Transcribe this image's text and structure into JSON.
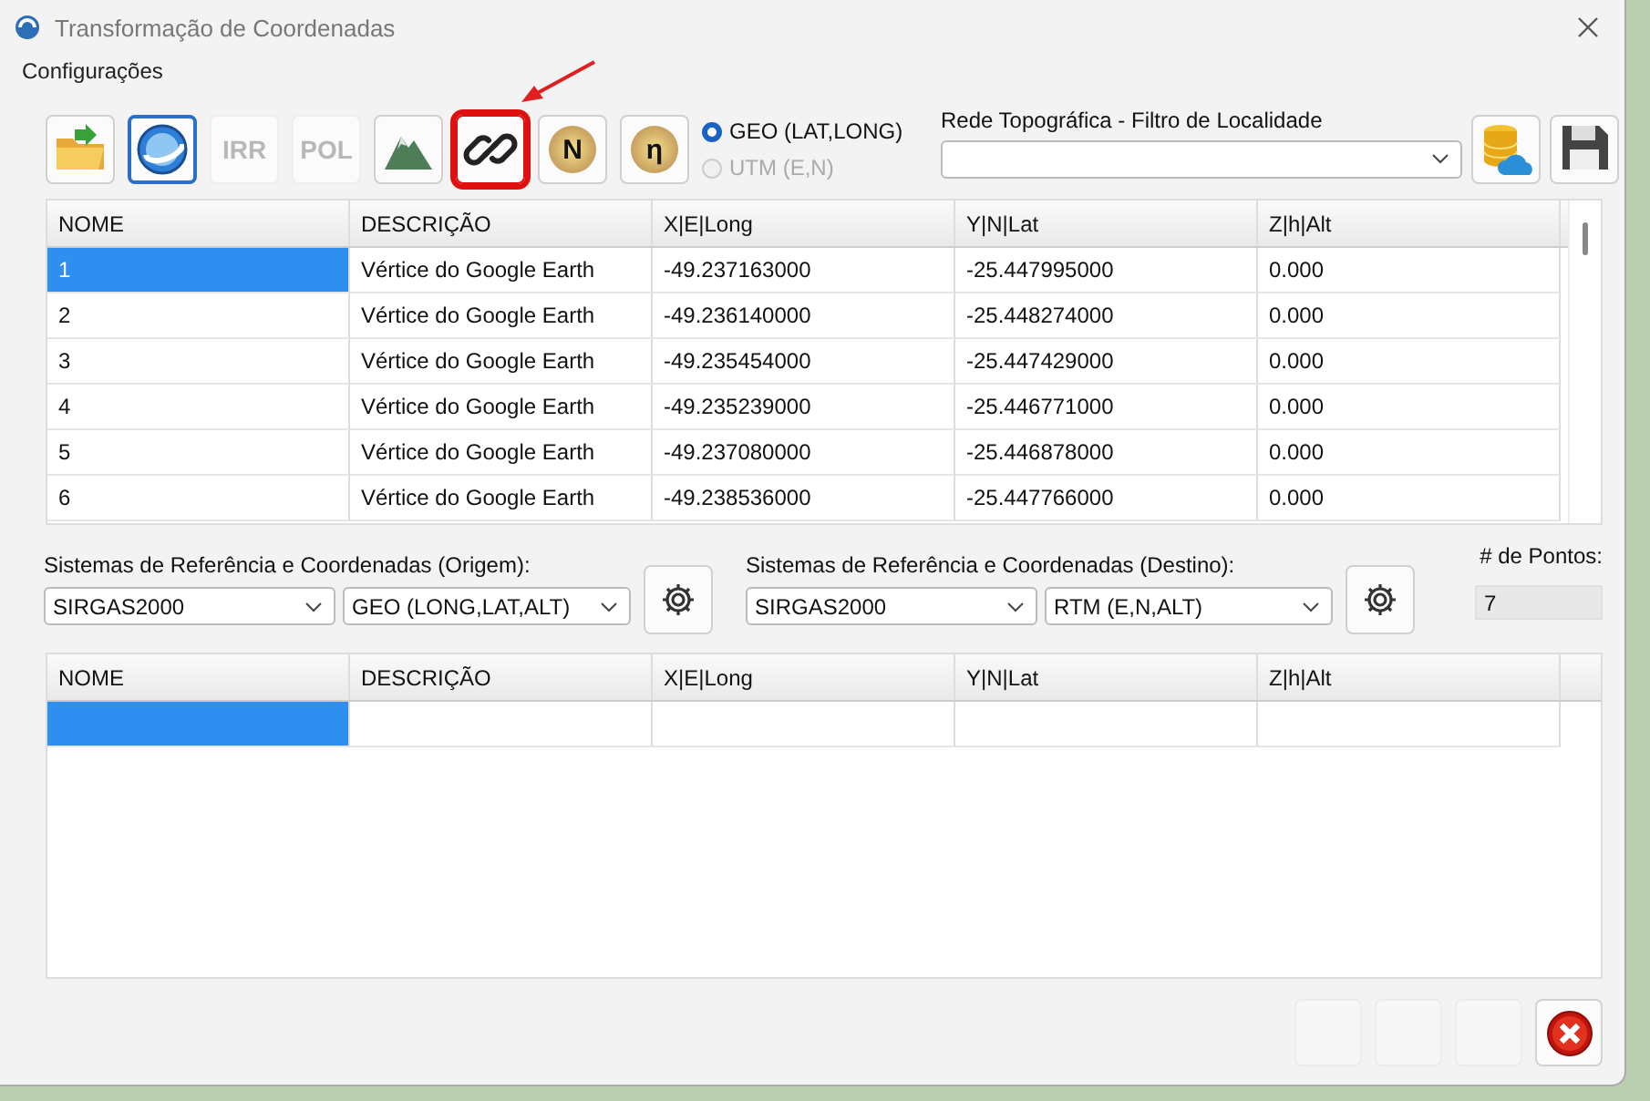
{
  "window": {
    "title": "Transformação de Coordenadas"
  },
  "menu": [
    "Configurações"
  ],
  "toolbar": {
    "buttons": [
      {
        "kind": "folder",
        "selected": false,
        "highlighted": false
      },
      {
        "kind": "globe",
        "selected": true,
        "highlighted": false
      },
      {
        "kind": "text",
        "label": "IRR",
        "selected": false,
        "highlighted": false
      },
      {
        "kind": "text",
        "label": "POL",
        "selected": false,
        "highlighted": false
      },
      {
        "kind": "mountain",
        "selected": false,
        "highlighted": false
      },
      {
        "kind": "link",
        "selected": false,
        "highlighted": true
      },
      {
        "kind": "letter",
        "label": "N",
        "selected": false,
        "highlighted": false
      },
      {
        "kind": "letter",
        "label": "η",
        "selected": false,
        "highlighted": false
      }
    ],
    "radios": [
      {
        "label": "GEO (LAT,LONG)",
        "selected": true,
        "disabled": false
      },
      {
        "label": "UTM (E,N)",
        "selected": false,
        "disabled": true
      }
    ],
    "filter_label": "Rede Topográfica - Filtro de Localidade",
    "right_buttons": [
      {
        "kind": "database-cloud"
      },
      {
        "kind": "floppy"
      }
    ]
  },
  "input_table": {
    "columns": [
      "NOME",
      "DESCRIÇÃO",
      "X|E|Long",
      "Y|N|Lat",
      "Z|h|Alt"
    ],
    "rows": [
      {
        "cells": [
          "1",
          "Vértice do Google Earth",
          "-49.237163000",
          "-25.447995000",
          "0.000"
        ],
        "selected": true
      },
      {
        "cells": [
          "2",
          "Vértice do Google Earth",
          "-49.236140000",
          "-25.448274000",
          "0.000"
        ],
        "selected": false
      },
      {
        "cells": [
          "3",
          "Vértice do Google Earth",
          "-49.235454000",
          "-25.447429000",
          "0.000"
        ],
        "selected": false
      },
      {
        "cells": [
          "4",
          "Vértice do Google Earth",
          "-49.235239000",
          "-25.446771000",
          "0.000"
        ],
        "selected": false
      },
      {
        "cells": [
          "5",
          "Vértice do Google Earth",
          "-49.237080000",
          "-25.446878000",
          "0.000"
        ],
        "selected": false
      },
      {
        "cells": [
          "6",
          "Vértice do Google Earth",
          "-49.238536000",
          "-25.447766000",
          "0.000"
        ],
        "selected": false
      }
    ]
  },
  "origin": {
    "label": "Sistemas de Referência e Coordenadas (Origem):",
    "datum": "SIRGAS2000",
    "system": "GEO (LONG,LAT,ALT)"
  },
  "destination": {
    "label": "Sistemas de Referência e Coordenadas (Destino):",
    "datum": "SIRGAS2000",
    "system": "RTM (E,N,ALT)"
  },
  "points": {
    "label": "# de Pontos:",
    "value": "7"
  },
  "output_table": {
    "columns": [
      "NOME",
      "DESCRIÇÃO",
      "X|E|Long",
      "Y|N|Lat",
      "Z|h|Alt"
    ],
    "current_row_selected": true
  },
  "bottom_buttons": [
    {
      "kind": "blank",
      "disabled": true
    },
    {
      "kind": "blank",
      "disabled": true
    },
    {
      "kind": "blank",
      "disabled": true
    },
    {
      "kind": "cancel",
      "disabled": false
    }
  ]
}
